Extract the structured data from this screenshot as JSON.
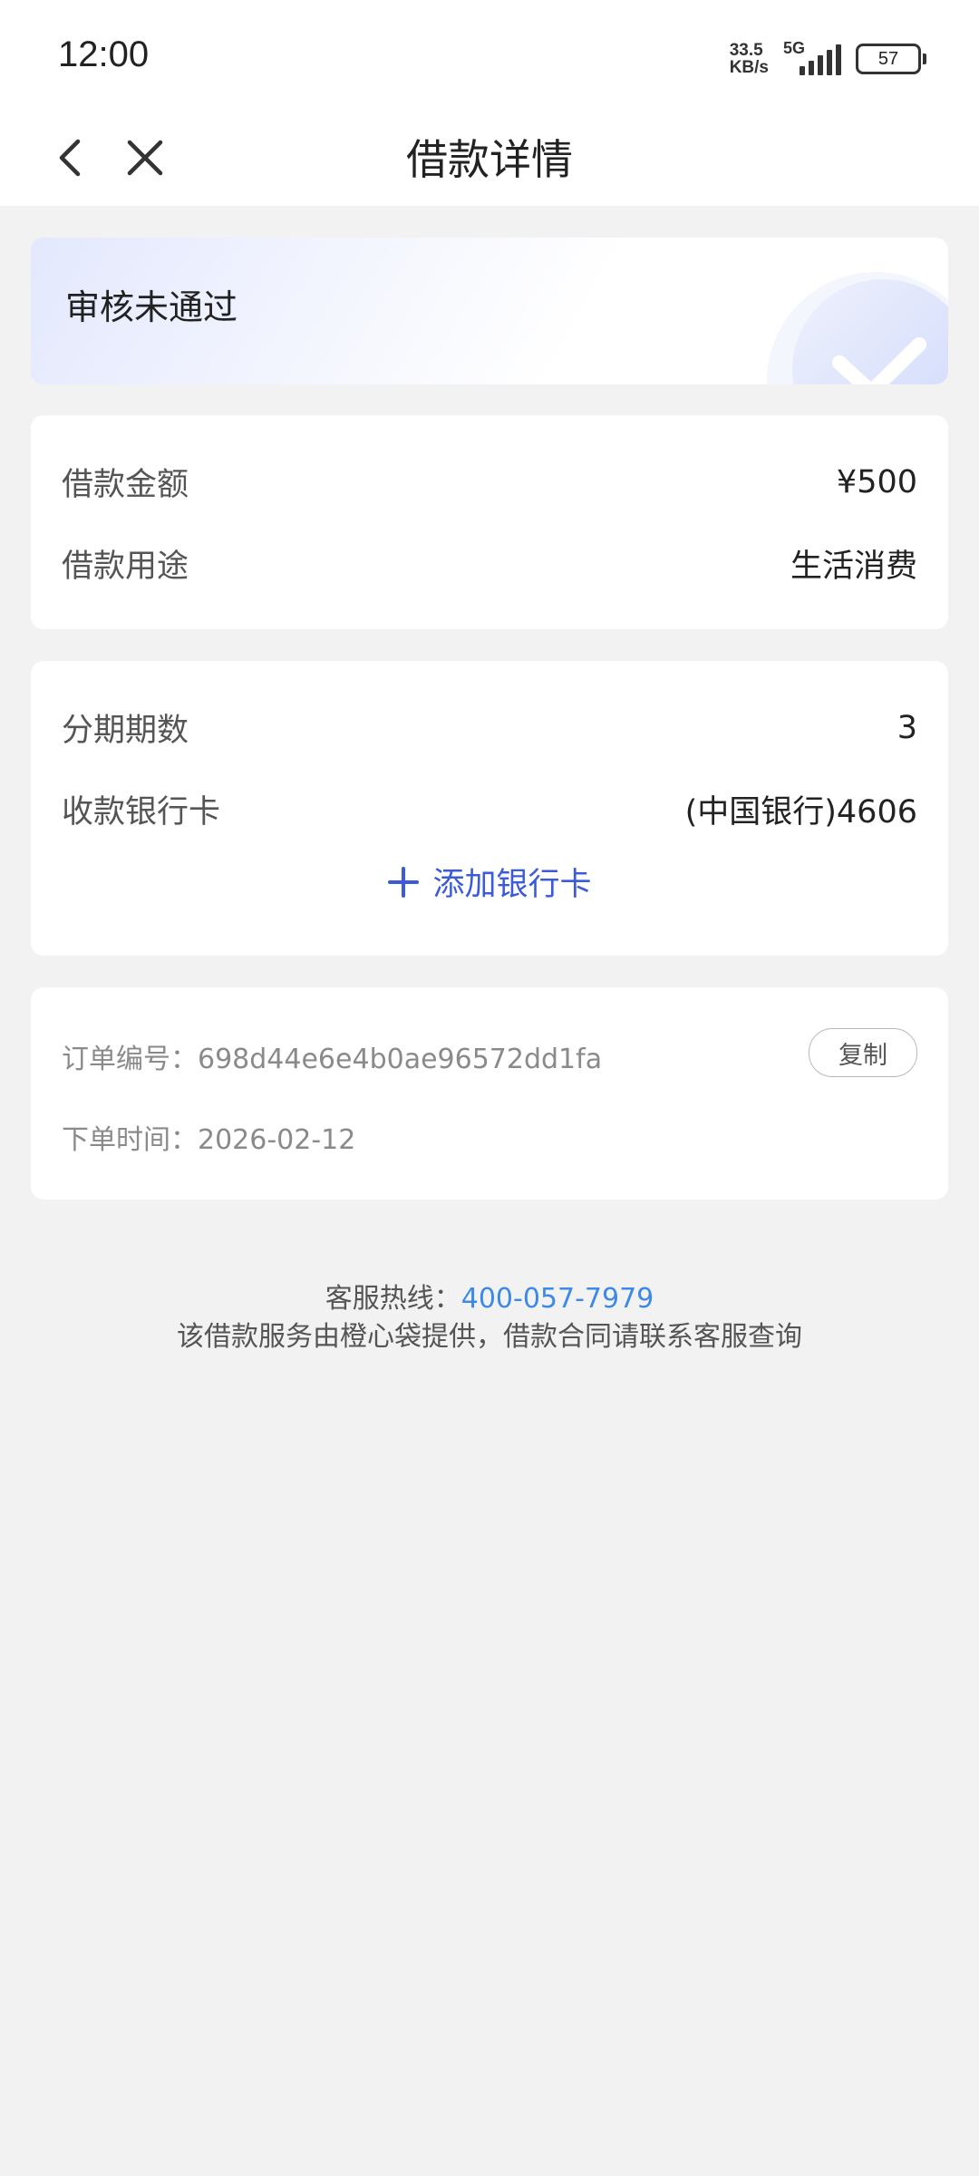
{
  "status_bar": {
    "time": "12:00",
    "net_speed_value": "33.5",
    "net_speed_unit": "KB/s",
    "network": "5G",
    "battery": "57"
  },
  "nav": {
    "back_icon": "chevron-left-icon",
    "close_icon": "close-icon",
    "title": "借款详情"
  },
  "status_card": {
    "text": "审核未通过",
    "icon": "check-circle-icon",
    "accent": "#c9d3fb"
  },
  "loan": {
    "amount_label": "借款金额",
    "amount_value": "¥500",
    "purpose_label": "借款用途",
    "purpose_value": "生活消费"
  },
  "installment": {
    "periods_label": "分期期数",
    "periods_value": "3",
    "bank_label": "收款银行卡",
    "bank_value": "(中国银行)4606",
    "add_card_label": "添加银行卡",
    "add_icon": "plus-icon"
  },
  "order": {
    "number_label": "订单编号：",
    "number_value": "698d44e6e4b0ae96572dd1fa",
    "copy_label": "复制",
    "time_label": "下单时间：",
    "time_value": "2026-02-12"
  },
  "footer": {
    "hotline_label": "客服热线：",
    "hotline_number": "400-057-7979",
    "note": "该借款服务由橙心袋提供，借款合同请联系客服查询"
  },
  "colors": {
    "link_blue": "#3b5bdb",
    "phone_blue": "#3c8ae6",
    "page_bg": "#f2f2f2"
  }
}
